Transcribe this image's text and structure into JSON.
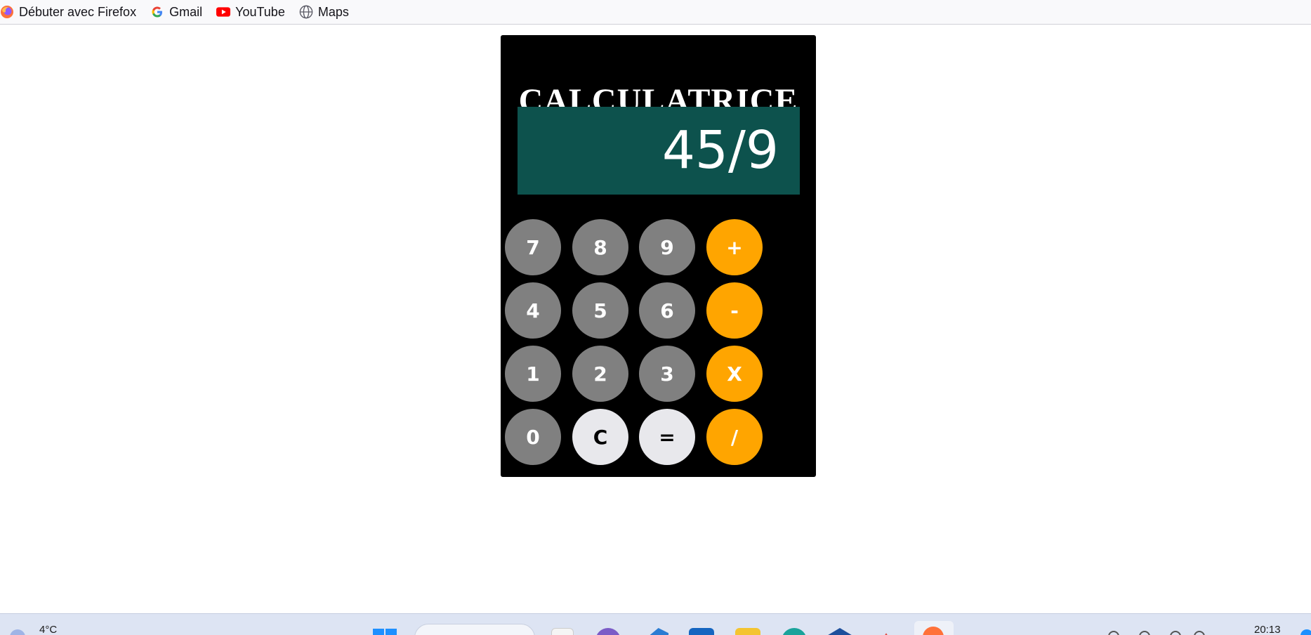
{
  "bookmarks": [
    {
      "label": "Débuter avec Firefox",
      "icon": "firefox-icon"
    },
    {
      "label": "Gmail",
      "icon": "google-icon"
    },
    {
      "label": "YouTube",
      "icon": "youtube-icon"
    },
    {
      "label": "Maps",
      "icon": "globe-icon"
    }
  ],
  "calculator": {
    "title": "CALCULATRICE",
    "display": "45/9",
    "keys": [
      [
        "7",
        "8",
        "9",
        "+"
      ],
      [
        "4",
        "5",
        "6",
        "-"
      ],
      [
        "1",
        "2",
        "3",
        "X"
      ],
      [
        "0",
        "C",
        "=",
        "/"
      ]
    ],
    "colors": {
      "body": "#000000",
      "screen": "#0d524d",
      "number_key": "#808080",
      "operator_key": "#ffa500",
      "function_key": "#e8e8ec"
    }
  },
  "taskbar": {
    "temperature": "4°C",
    "clock": "20:13"
  }
}
